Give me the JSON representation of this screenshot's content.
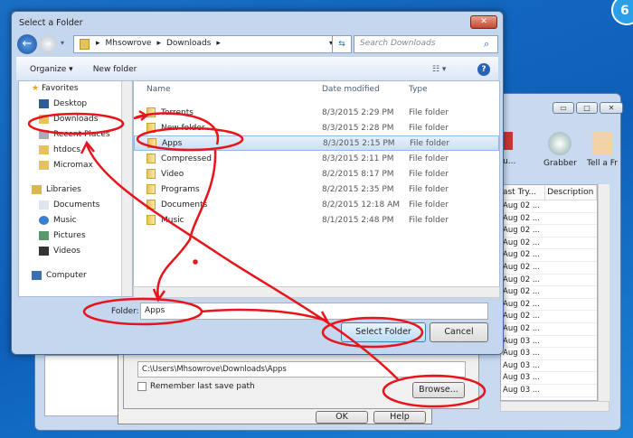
{
  "desktop": {
    "badge": "6"
  },
  "background_app": {
    "toolbar": [
      {
        "label": "Qu..."
      },
      {
        "label": "Grabber"
      },
      {
        "label": "Tell a Fr"
      }
    ],
    "columns": [
      "ast Try...",
      "Description"
    ],
    "rows": [
      "Aug 02 ...",
      "Aug 02 ...",
      "Aug 02 ...",
      "Aug 02 ...",
      "Aug 02 ...",
      "Aug 02 ...",
      "Aug 02 ...",
      "Aug 02 ...",
      "Aug 02 ...",
      "Aug 02 ...",
      "Aug 02 ...",
      "Aug 03 ...",
      "Aug 03 ...",
      "Aug 03 ...",
      "Aug 03 ...",
      "Aug 03 ..."
    ]
  },
  "save_dialog": {
    "path": "C:\\Users\\Mhsowrove\\Downloads\\Apps",
    "remember_label": "Remember last save path",
    "browse_label": "Browse...",
    "ok_label": "OK",
    "help_label": "Help"
  },
  "folder_dialog": {
    "title": "Select a Folder",
    "breadcrumb": [
      "Mhsowrove",
      "Downloads"
    ],
    "search_placeholder": "Search Downloads",
    "toolbar": {
      "organize": "Organize ▾",
      "new_folder": "New folder"
    },
    "nav": {
      "favorites": "Favorites",
      "favorites_items": [
        "Desktop",
        "Downloads",
        "Recent Places",
        "htdocs",
        "Micromax"
      ],
      "libraries": "Libraries",
      "libraries_items": [
        "Documents",
        "Music",
        "Pictures",
        "Videos"
      ],
      "computer": "Computer"
    },
    "columns": {
      "name": "Name",
      "date": "Date modified",
      "type": "Type"
    },
    "files": [
      {
        "name": "Torrents",
        "date": "8/3/2015 2:29 PM",
        "type": "File folder"
      },
      {
        "name": "New folder",
        "date": "8/3/2015 2:28 PM",
        "type": "File folder"
      },
      {
        "name": "Apps",
        "date": "8/3/2015 2:15 PM",
        "type": "File folder",
        "selected": true
      },
      {
        "name": "Compressed",
        "date": "8/3/2015 2:11 PM",
        "type": "File folder"
      },
      {
        "name": "Video",
        "date": "8/2/2015 8:17 PM",
        "type": "File folder"
      },
      {
        "name": "Programs",
        "date": "8/2/2015 2:35 PM",
        "type": "File folder"
      },
      {
        "name": "Documents",
        "date": "8/2/2015 12:18 AM",
        "type": "File folder"
      },
      {
        "name": "Music",
        "date": "8/1/2015 2:48 PM",
        "type": "File folder"
      }
    ],
    "folder_label": "Folder:",
    "folder_value": "Apps",
    "select_label": "Select Folder",
    "cancel_label": "Cancel"
  },
  "colors": {
    "annotation": "#e8141c",
    "selection": "#c9e0f7"
  }
}
